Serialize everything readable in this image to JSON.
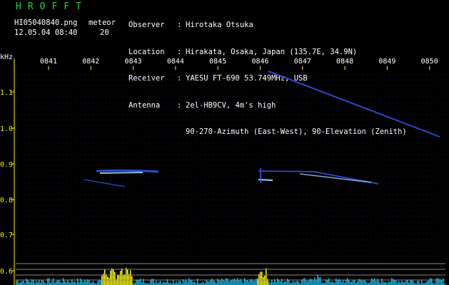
{
  "title": "HROFFT",
  "file": "HI05040840.png",
  "meteor_label": "meteor",
  "timestamp": "12.05.04 08:40",
  "meteor_count": "20",
  "info": [
    {
      "key": "Observer",
      "value": "Hirotaka Otsuka"
    },
    {
      "key": "Location",
      "value": "Hirakata, Osaka, Japan (135.7E, 34.9N)"
    },
    {
      "key": "Receiver",
      "value": "YAESU FT-690 53.749MHz, USB"
    },
    {
      "key": "Antenna",
      "value": "2el-HB9CV, 4m's high"
    },
    {
      "key": "",
      "value": "90-270-Azimuth (East-West), 90-Elevation (Zenith)"
    }
  ],
  "y_unit": "kHz",
  "x_ticks": [
    "0841",
    "0842",
    "0843",
    "0844",
    "0845",
    "0846",
    "0847",
    "0848",
    "0849",
    "0850"
  ],
  "y_ticks": [
    "1.1",
    "1.0",
    "0.9",
    "0.8",
    "0.7",
    "0.6"
  ],
  "colors": {
    "background": "#000000",
    "grid": "#1d2a6a",
    "signal": "#3a5cff",
    "signal_bright": "#9bd0ff",
    "axis": "#ffff00",
    "spectrum": "#11b8e8",
    "spectrum_peak": "#ffff00",
    "header": "#ffffff",
    "logo": "#2ecc40"
  }
}
